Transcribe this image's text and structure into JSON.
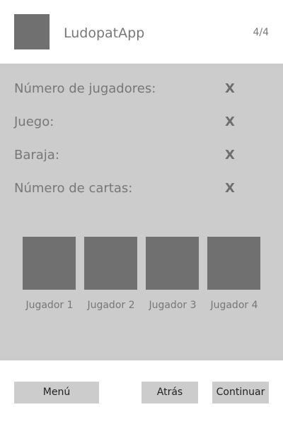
{
  "header": {
    "app_title": "LudopatApp",
    "step": "4/4",
    "logo_icon": "app-logo-placeholder"
  },
  "summary": [
    {
      "label": "Número de jugadores:",
      "value": "X"
    },
    {
      "label": "Juego:",
      "value": "X"
    },
    {
      "label": "Baraja:",
      "value": "X"
    },
    {
      "label": "Número de cartas:",
      "value": "X"
    }
  ],
  "players": [
    {
      "label": "Jugador 1",
      "icon": "player-avatar-placeholder"
    },
    {
      "label": "Jugador 2",
      "icon": "player-avatar-placeholder"
    },
    {
      "label": "Jugador 3",
      "icon": "player-avatar-placeholder"
    },
    {
      "label": "Jugador 4",
      "icon": "player-avatar-placeholder"
    }
  ],
  "footer": {
    "menu_label": "Menú",
    "back_label": "Atrás",
    "continue_label": "Continuar"
  },
  "colors": {
    "panel": "#cccccc",
    "placeholder": "#707070",
    "text": "#777777",
    "background": "#ffffff"
  }
}
